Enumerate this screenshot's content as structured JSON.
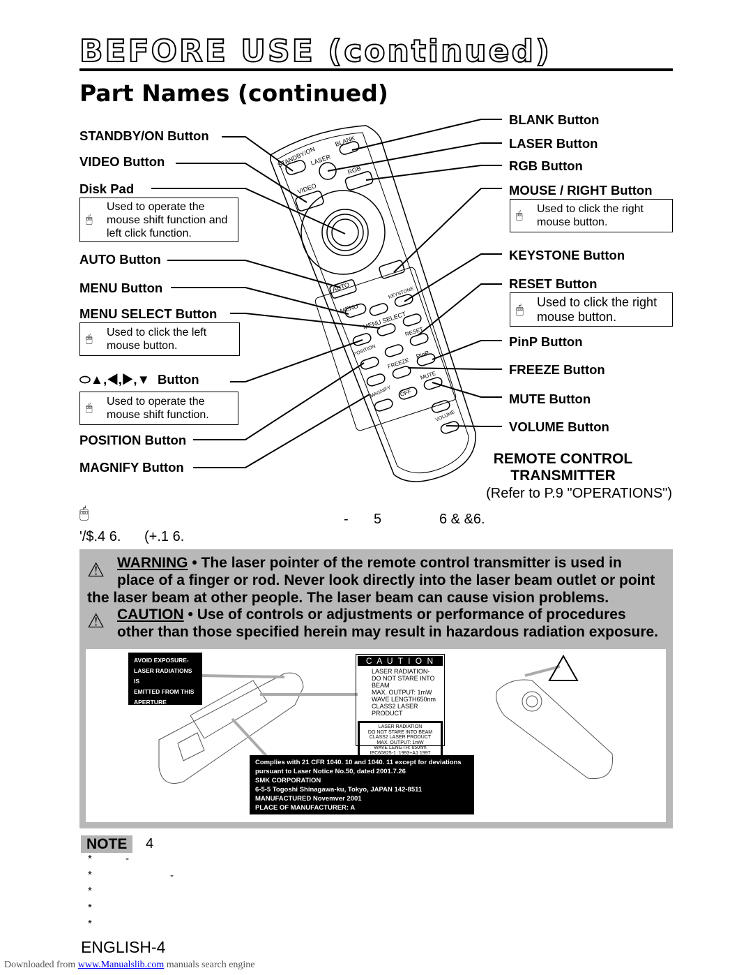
{
  "header": {
    "section_title": "BEFORE USE (continued)",
    "subtitle": "Part Names (continued)"
  },
  "left_labels": {
    "standby": "STANDBY/ON Button",
    "video": "VIDEO Button",
    "disk_pad": "Disk Pad",
    "disk_pad_note": "Used to operate the mouse shift function and left click function.",
    "auto": "AUTO Button",
    "menu": "MENU Button",
    "menu_select": "MENU SELECT Button",
    "menu_select_note": "Used to click the left mouse button.",
    "arrows": "Button",
    "arrows_sep": ",",
    "arrows_note": "Used to operate the mouse shift function.",
    "position": "POSITION Button",
    "magnify": "MAGNIFY Button"
  },
  "right_labels": {
    "blank": "BLANK Button",
    "laser": "LASER Button",
    "rgb": "RGB Button",
    "mouse_right": "MOUSE / RIGHT Button",
    "mouse_right_note": "Used to click the right mouse button.",
    "keystone": "KEYSTONE Button",
    "reset": "RESET Button",
    "reset_note": "Used to click the right mouse button.",
    "pinp": "PinP Button",
    "freeze": "FREEZE Button",
    "mute": "MUTE Button",
    "volume": "VOLUME Button"
  },
  "remote": {
    "title1": "REMOTE CONTROL",
    "title2": "TRANSMITTER",
    "ref": "(Refer to P.9 \"OPERATIONS\")",
    "buttons": {
      "standby": "STANDBY/ON",
      "laser": "LASER",
      "blank": "BLANK",
      "rgb": "RGB",
      "video": "VIDEO",
      "auto": "AUTO",
      "keystone": "KEYSTONE",
      "menu": "MENU",
      "menu_select": "MENU SELECT",
      "reset": "RESET",
      "position": "POSITION",
      "pinp": "PinP",
      "freeze": "FREEZE",
      "magnify": "MAGNIFY",
      "off": "OFF",
      "mute": "MUTE",
      "volume": "VOLUME"
    }
  },
  "garbled": {
    "a": "-",
    "b": "5",
    "c": "6 & &6.",
    "d": "'/$.4 6.",
    "e": "(+.1 6."
  },
  "warning": {
    "label": "WARNING",
    "text1": " • The laser pointer of the remote control transmitter is used in",
    "text2": "place of a finger or rod. Never look directly into the laser beam outlet or point",
    "text3": "the laser beam at other people. The laser beam can cause vision problems.",
    "caution_label": "CAUTION",
    "caution1": " • Use of controls or adjustments or performance of procedures",
    "caution2": "other than those specified herein may result in hazardous radiation exposure."
  },
  "labels_img": {
    "avoid": [
      "AVOID  EXPOSURE-",
      "LASER RADIATIONS IS",
      "EMITTED  FROM  THIS",
      "APERTURE"
    ],
    "caution_title": "C A U T I O N",
    "caution_lines": [
      "LASER  RADIATION-",
      "DO NOT STARE INTO BEAM",
      "MAX. OUTPUT:  1mW",
      "WAVE LENGTH650nm",
      "CLASS2 LASER PRODUCT"
    ],
    "inner_lines": [
      "LASER RADIATION",
      "DO NOT STARE INTO BEAM",
      "CLASS2 LASER PRODUCT",
      "MAX.  OUTPUT:  1mW",
      "WAVE LENGTH:  650nm",
      "IEC60825-1 :1993+A1:1997"
    ],
    "complies": [
      "Complies with 21 CFR 1040. 10 and 1040. 11 except for deviations",
      "pursuant  to  Laser  Notice  No.50,  dated  2001.7.26",
      "SMK CORPORATION",
      "6-5-5  Togoshi  Shinagawa-ku,  Tokyo,  JAPAN 142-8511",
      "MANUFACTURED   Novemver  2001",
      "PLACE  OF  MANUFACTURER:  A"
    ]
  },
  "note": {
    "label": "NOTE",
    "text": "4",
    "bullets": [
      "*",
      "*",
      "*",
      "*",
      "*"
    ],
    "dash1": "-",
    "dash2": "-"
  },
  "footer": {
    "page": "ENGLISH-4",
    "downloaded": "Downloaded from ",
    "link": "www.Manualslib.com",
    "suffix": " manuals search engine"
  }
}
